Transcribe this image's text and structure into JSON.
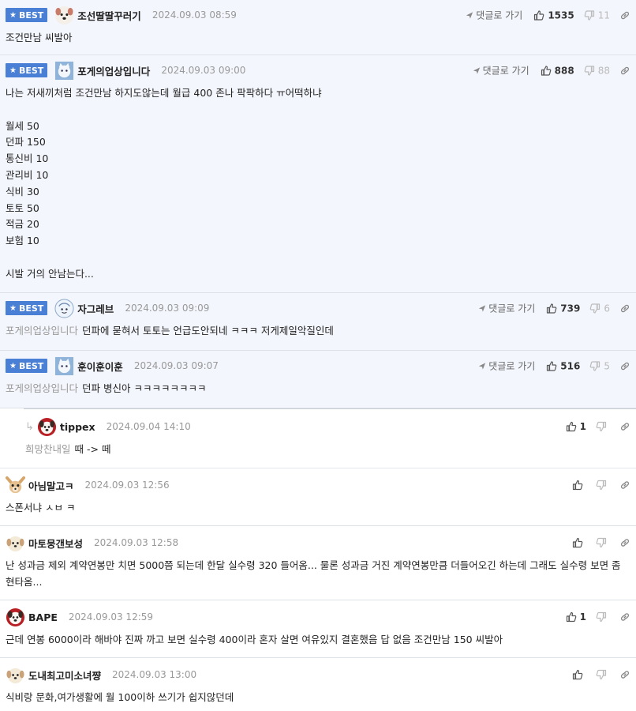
{
  "ui": {
    "goto_label": "댓글로 가기",
    "best_label": "BEST"
  },
  "comments": [
    {
      "nick": "조선딸딸꾸러기",
      "date": "2024.09.03 08:59",
      "up": "1535",
      "down": "11",
      "text": "조건만남 씨발아"
    },
    {
      "nick": "포게의업상입니다",
      "date": "2024.09.03 09:00",
      "up": "888",
      "down": "88",
      "text": "나는 저새끼처럼 조건만남 하지도않는데 월급 400 존나 팍팍하다 ㅠ어떡하냐\n\n월세 50\n던파 150\n통신비 10\n관리비 10\n식비 30\n토토 50\n적금 20\n보험 10\n\n시발 거의 안남는다..."
    },
    {
      "nick": "자그레브",
      "date": "2024.09.03 09:09",
      "up": "739",
      "down": "6",
      "mention": "포게의업상입니다",
      "text": "던파에 묻혀서 토토는 언급도안되네 ㅋㅋㅋ 저게제일악질인데"
    },
    {
      "nick": "훈이훈이훈",
      "date": "2024.09.03 09:07",
      "up": "516",
      "down": "5",
      "mention": "포게의업상입니다",
      "text": "던파 병신아 ㅋㅋㅋㅋㅋㅋㅋㅋ"
    },
    {
      "nick": "tippex",
      "date": "2024.09.04 14:10",
      "up": "1",
      "mention": "희망찬내일",
      "text": "때 -> 떼"
    },
    {
      "nick": "아님말고ㅋ",
      "date": "2024.09.03 12:56",
      "text": "스폰서냐 ㅅㅂ ㅋ"
    },
    {
      "nick": "마토뭉갠보성",
      "date": "2024.09.03 12:58",
      "text": "난 성과금 제외 계약연봉만 치면 5000쯤 되는데 한달 실수령 320 들어옴... 물론 성과금 거진 계약연봉만큼 더들어오긴 하는데 그래도 실수령 보면 좀 현타옴..."
    },
    {
      "nick": "BAPE",
      "date": "2024.09.03 12:59",
      "up": "1",
      "text": "근데 연봉 6000이라 해바야 진짜 까고 보면 실수령 400이라 혼자 살면 여유있지 결혼했음 답 없음 조건만남 150 씨발아"
    },
    {
      "nick": "도내최고미소녀쨩",
      "date": "2024.09.03 13:00",
      "text": "식비랑 문화,여가생활에 월 100이하 쓰기가 쉽지않던데"
    }
  ]
}
